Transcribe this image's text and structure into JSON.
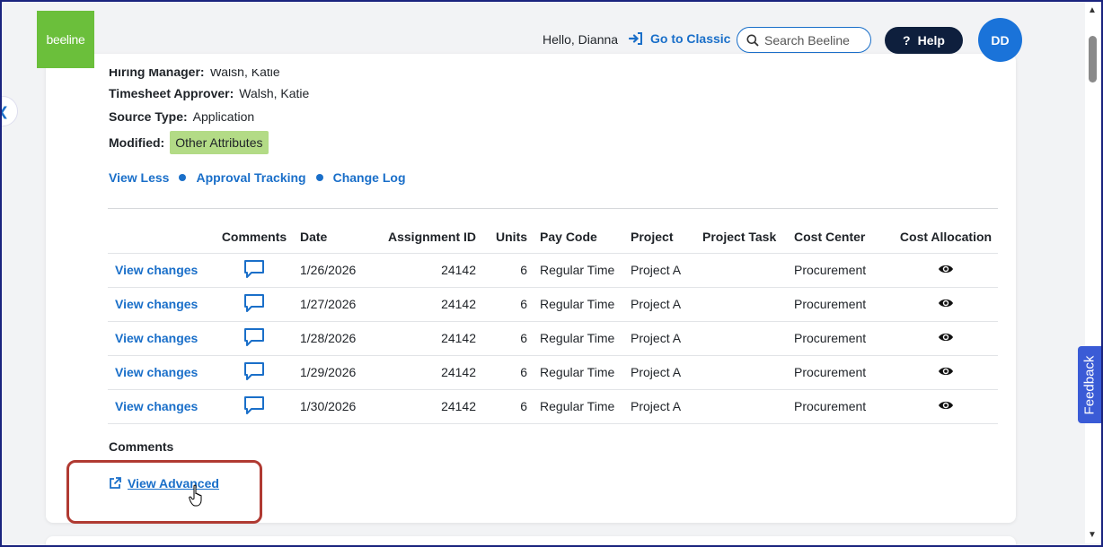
{
  "header": {
    "logo_text": "beeline",
    "greeting": "Hello, Dianna",
    "go_to_classic": "Go to Classic",
    "search_placeholder": "Search Beeline",
    "help": "Help",
    "help_glyph": "?",
    "avatar_initials": "DD"
  },
  "details": {
    "hiring_manager_label": "Hiring Manager:",
    "hiring_manager_value": "Walsh, Katie",
    "approver_label": "Timesheet Approver:",
    "approver_value": "Walsh, Katie",
    "source_label": "Source Type:",
    "source_value": "Application",
    "modified_label": "Modified:",
    "modified_value": "Other Attributes"
  },
  "links": {
    "view_less": "View Less",
    "approval_tracking": "Approval Tracking",
    "change_log": "Change Log"
  },
  "table": {
    "headers": [
      "",
      "Comments",
      "Date",
      "Assignment ID",
      "Units",
      "Pay Code",
      "Project",
      "Project Task",
      "Cost Center",
      "Cost Allocation"
    ],
    "rows": [
      {
        "action": "View changes",
        "date": "1/26/2026",
        "assignment_id": "24142",
        "units": "6",
        "pay_code": "Regular Time",
        "project": "Project A",
        "project_task": "",
        "cost_center": "Procurement"
      },
      {
        "action": "View changes",
        "date": "1/27/2026",
        "assignment_id": "24142",
        "units": "6",
        "pay_code": "Regular Time",
        "project": "Project A",
        "project_task": "",
        "cost_center": "Procurement"
      },
      {
        "action": "View changes",
        "date": "1/28/2026",
        "assignment_id": "24142",
        "units": "6",
        "pay_code": "Regular Time",
        "project": "Project A",
        "project_task": "",
        "cost_center": "Procurement"
      },
      {
        "action": "View changes",
        "date": "1/29/2026",
        "assignment_id": "24142",
        "units": "6",
        "pay_code": "Regular Time",
        "project": "Project A",
        "project_task": "",
        "cost_center": "Procurement"
      },
      {
        "action": "View changes",
        "date": "1/30/2026",
        "assignment_id": "24142",
        "units": "6",
        "pay_code": "Regular Time",
        "project": "Project A",
        "project_task": "",
        "cost_center": "Procurement"
      }
    ]
  },
  "comments_label": "Comments",
  "view_advanced": "View Advanced",
  "feedback": "Feedback",
  "colors": {
    "link_blue": "#1a6fc9",
    "logo_green": "#6bbf3b",
    "help_navy": "#0e1f3d",
    "badge_green": "#b3db86",
    "highlight_red": "#b03a32",
    "feedback_blue": "#3a5bd6"
  }
}
